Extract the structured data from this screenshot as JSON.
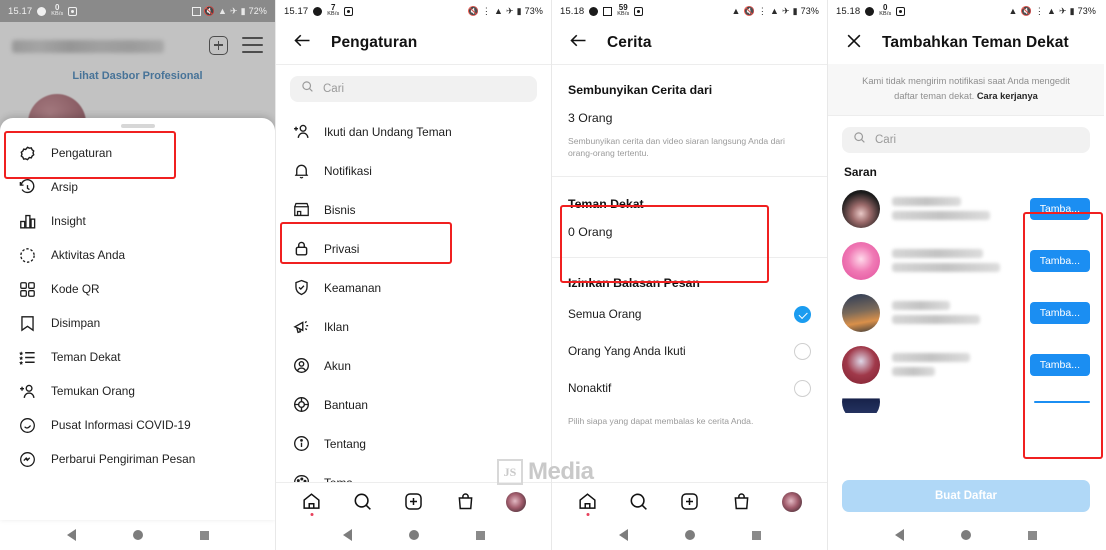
{
  "panels": {
    "profile": {
      "status": {
        "time": "15.17",
        "kbps": "0",
        "battery": "72%"
      },
      "dashboard_link": "Lihat Dasbor Profesional",
      "sheet_items": [
        {
          "label": "Pengaturan",
          "icon": "gear-icon"
        },
        {
          "label": "Arsip",
          "icon": "archive-clock-icon"
        },
        {
          "label": "Insight",
          "icon": "bar-chart-icon"
        },
        {
          "label": "Aktivitas Anda",
          "icon": "activity-clock-icon"
        },
        {
          "label": "Kode QR",
          "icon": "qr-code-icon"
        },
        {
          "label": "Disimpan",
          "icon": "bookmark-icon"
        },
        {
          "label": "Teman Dekat",
          "icon": "close-friends-list-icon"
        },
        {
          "label": "Temukan Orang",
          "icon": "add-person-icon"
        },
        {
          "label": "Pusat Informasi COVID-19",
          "icon": "covid-info-icon"
        },
        {
          "label": "Perbarui Pengiriman Pesan",
          "icon": "messenger-icon"
        }
      ]
    },
    "settings": {
      "status": {
        "time": "15.17",
        "kbps": "7",
        "battery": "73%"
      },
      "title": "Pengaturan",
      "search_placeholder": "Cari",
      "items": [
        {
          "label": "Ikuti dan Undang Teman",
          "icon": "add-person-icon"
        },
        {
          "label": "Notifikasi",
          "icon": "bell-icon"
        },
        {
          "label": "Bisnis",
          "icon": "store-icon"
        },
        {
          "label": "Privasi",
          "icon": "lock-icon"
        },
        {
          "label": "Keamanan",
          "icon": "shield-check-icon"
        },
        {
          "label": "Iklan",
          "icon": "megaphone-icon"
        },
        {
          "label": "Akun",
          "icon": "person-circle-icon"
        },
        {
          "label": "Bantuan",
          "icon": "lifebuoy-icon"
        },
        {
          "label": "Tentang",
          "icon": "info-icon"
        },
        {
          "label": "Tema",
          "icon": "palette-icon"
        }
      ]
    },
    "story": {
      "status": {
        "time": "15.18",
        "kbps": "59",
        "battery": "73%"
      },
      "title": "Cerita",
      "hide_story_heading": "Sembunyikan Cerita dari",
      "hide_story_value": "3 Orang",
      "hide_story_note": "Sembunyikan cerita dan video siaran langsung Anda dari orang-orang tertentu.",
      "close_friends_heading": "Teman Dekat",
      "close_friends_value": "0 Orang",
      "replies_heading": "Izinkan Balasan Pesan",
      "replies_options": [
        {
          "label": "Semua Orang",
          "selected": true
        },
        {
          "label": "Orang Yang Anda Ikuti",
          "selected": false
        },
        {
          "label": "Nonaktif",
          "selected": false
        }
      ],
      "replies_note": "Pilih siapa yang dapat membalas ke cerita Anda."
    },
    "add_close_friends": {
      "status": {
        "time": "15.18",
        "kbps": "0",
        "battery": "73%"
      },
      "title": "Tambahkan Teman Dekat",
      "notice_text": "Kami tidak mengirim notifikasi saat Anda mengedit daftar teman dekat. ",
      "notice_link": "Cara kerjanya",
      "search_placeholder": "Cari",
      "suggestions_heading": "Saran",
      "rows": [
        {
          "add_label": "Tamba..."
        },
        {
          "add_label": "Tamba..."
        },
        {
          "add_label": "Tamba..."
        },
        {
          "add_label": "Tamba..."
        }
      ],
      "cta_label": "Buat Daftar"
    }
  },
  "colors": {
    "accent_blue": "#1b8ef2",
    "highlight_red": "#f02020",
    "link_blue": "#1f6fb2",
    "cta_disabled": "#b0d8f7"
  },
  "watermark": {
    "badge": "JS",
    "text": "Media"
  }
}
